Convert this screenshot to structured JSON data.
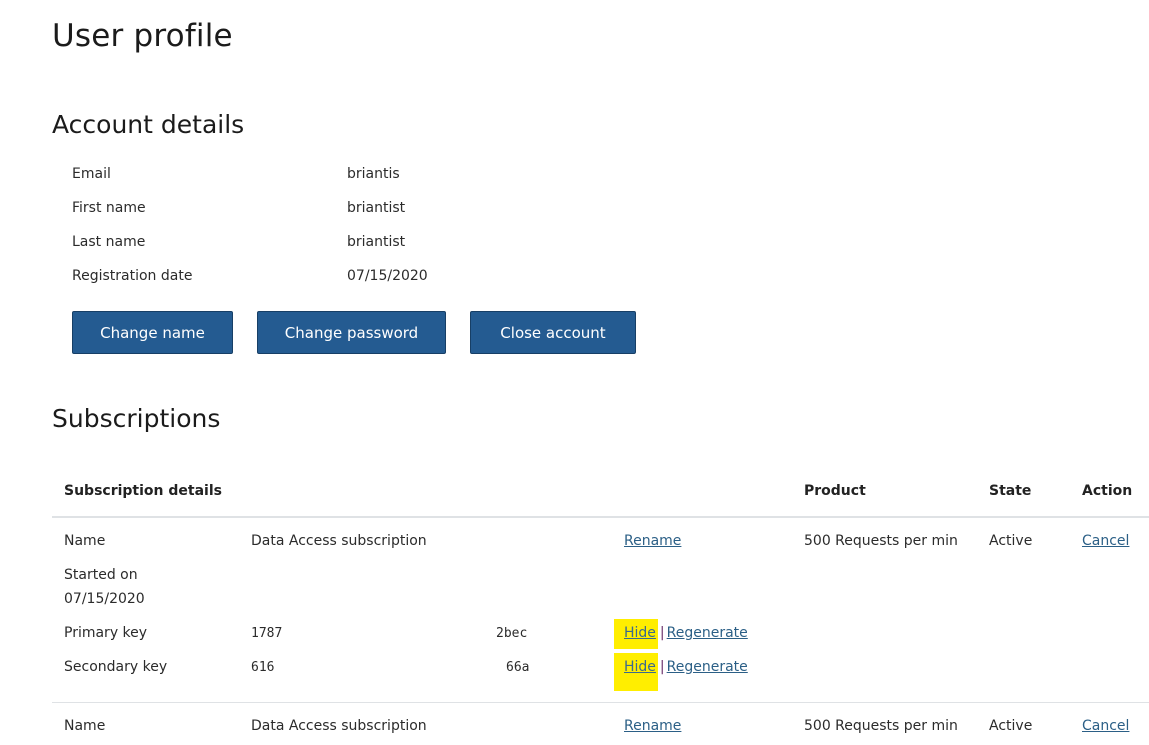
{
  "page": {
    "title": "User profile"
  },
  "account": {
    "heading": "Account details",
    "fields": [
      {
        "label": "Email",
        "value": "briantis"
      },
      {
        "label": "First name",
        "value": "briantist"
      },
      {
        "label": "Last name",
        "value": "briantist"
      },
      {
        "label": "Registration date",
        "value": "07/15/2020"
      }
    ],
    "buttons": {
      "change_name": "Change name",
      "change_password": "Change password",
      "close_account": "Close account"
    }
  },
  "subscriptions": {
    "heading": "Subscriptions",
    "columns": {
      "details": "Subscription details",
      "product": "Product",
      "state": "State",
      "action": "Action"
    },
    "rows": [
      {
        "name_label": "Name",
        "name": "Data Access subscription",
        "rename_link": "Rename",
        "product": "500 Requests per min",
        "state": "Active",
        "action_link": "Cancel",
        "started_label": "Started on",
        "started_date": "07/15/2020",
        "primary_key_label": "Primary key",
        "primary_key_start": "1787",
        "primary_key_end": "2bec",
        "secondary_key_label": "Secondary key",
        "secondary_key_start": "616",
        "secondary_key_end": "66a",
        "hide_link": "Hide",
        "separator": "|",
        "regenerate_link": "Regenerate"
      },
      {
        "name_label": "Name",
        "name": "Data Access subscription",
        "rename_link": "Rename",
        "product": "500 Requests per min",
        "state": "Active",
        "action_link": "Cancel"
      }
    ]
  },
  "colors": {
    "button_bg": "#245b91",
    "link": "#2b5f86",
    "highlight": "#ffee00",
    "divider": "#dfe2e5"
  }
}
